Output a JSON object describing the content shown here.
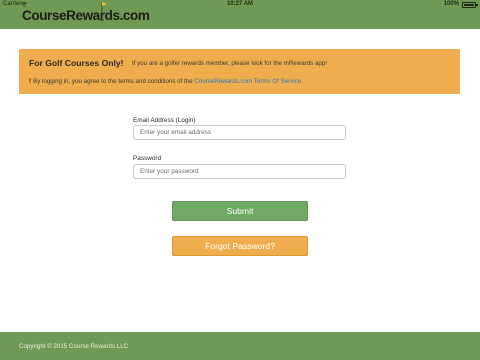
{
  "status_bar": {
    "carrier": "Carrier",
    "time": "10:27 AM",
    "battery": "100%"
  },
  "header": {
    "logo_text": "CourseRewards.com",
    "background_color": "#6e9a53"
  },
  "notice": {
    "title": "For Golf Courses Only!",
    "message": "If you are a golfer rewards member, please look for the mRewards app!",
    "terms_icon": "!",
    "terms_prefix": "By logging in, you agree to the terms and conditions of the",
    "terms_link": "CourseRewards.com Terms Of Service.",
    "background_color": "#f0ad4e"
  },
  "form": {
    "email_label": "Email Address (Login)",
    "email_placeholder": "Enter your email address",
    "email_value": "",
    "password_label": "Password",
    "password_placeholder": "Enter your password",
    "password_value": "",
    "submit_label": "Submit",
    "forgot_label": "Forgot Password?"
  },
  "footer": {
    "copyright": "Copyright © 2015 Course Rewards LLC"
  }
}
